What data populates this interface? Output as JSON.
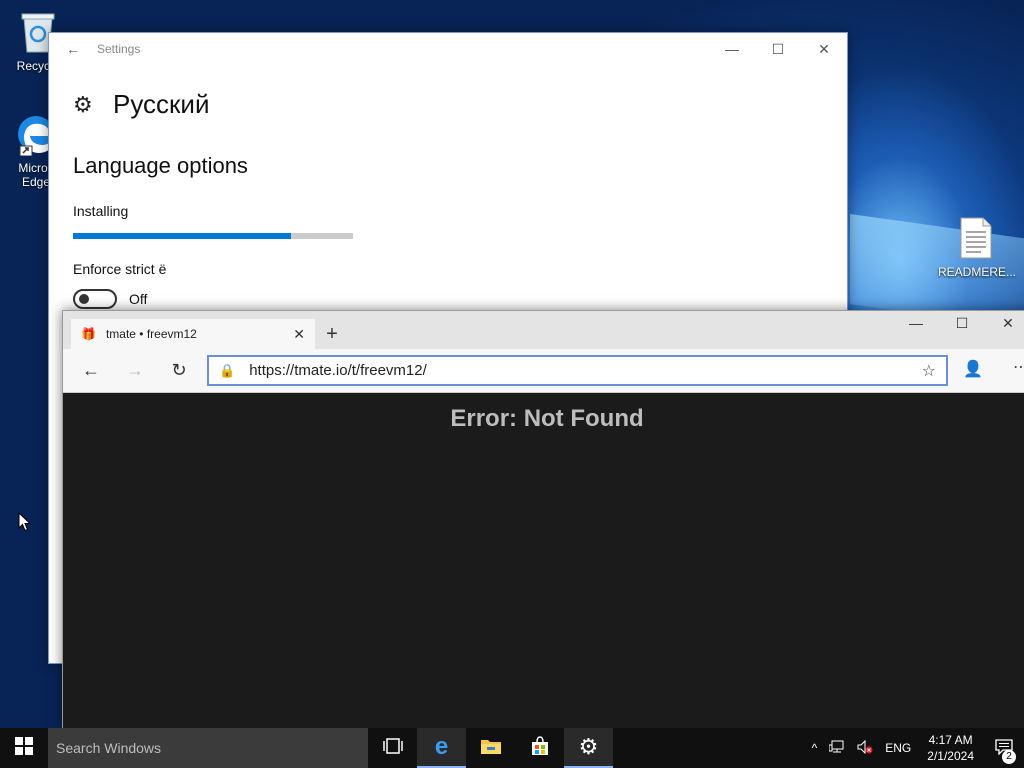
{
  "desktop": {
    "icons": [
      {
        "label": "Recycle",
        "icon": "recycle-bin-icon"
      },
      {
        "label": "Micros Edge",
        "icon": "edge-icon"
      },
      {
        "label": "READMERE...",
        "icon": "text-file-icon"
      }
    ]
  },
  "settings": {
    "title": "Settings",
    "back_icon": "←",
    "controls": {
      "minimize": "—",
      "maximize": "☐",
      "close": "✕"
    },
    "page_title": "Русский",
    "section_title": "Language options",
    "status": "Installing",
    "progress_fraction": 0.78,
    "option_label": "Enforce strict ё",
    "toggle_state": "Off",
    "accent": "#0078d7"
  },
  "edge": {
    "tab_title": "tmate • freevm12",
    "tab_close": "✕",
    "new_tab": "+",
    "controls": {
      "minimize": "—",
      "maximize": "☐",
      "close": "✕"
    },
    "url": "https://tmate.io/t/freevm12/",
    "page_error": "Error: Not Found"
  },
  "taskbar": {
    "search_placeholder": "Search Windows",
    "language": "ENG",
    "time": "4:17 AM",
    "date": "2/1/2024",
    "notification_count": "2"
  }
}
